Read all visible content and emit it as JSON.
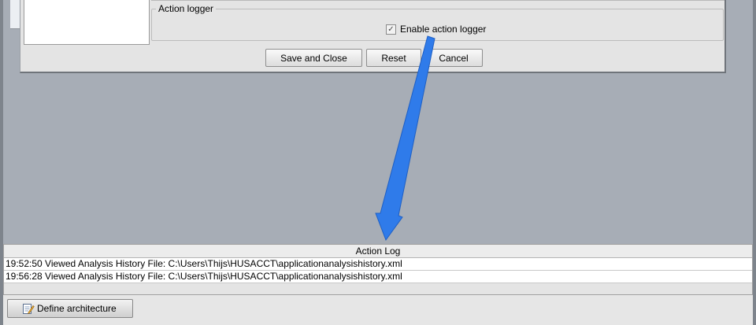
{
  "dialog": {
    "section_title": "Action logger",
    "checkbox_label": "Enable action logger",
    "checkbox_checked": true,
    "buttons": {
      "save_close": "Save and Close",
      "reset": "Reset",
      "cancel": "Cancel"
    }
  },
  "action_log": {
    "header": "Action Log",
    "rows": [
      "19:52:50 Viewed Analysis History File: C:\\Users\\Thijs\\HUSACCT\\applicationanalysishistory.xml",
      "19:56:28 Viewed Analysis History File: C:\\Users\\Thijs\\HUSACCT\\applicationanalysishistory.xml"
    ]
  },
  "toolbar": {
    "define_architecture_label": "Define architecture",
    "define_architecture_icon": "edit-document-icon"
  },
  "annotation": {
    "arrow_color": "#2f7bea",
    "arrow_icon": "pointer-arrow-icon"
  },
  "colors": {
    "background": "#a7adb6",
    "panel": "#e4e4e4"
  }
}
